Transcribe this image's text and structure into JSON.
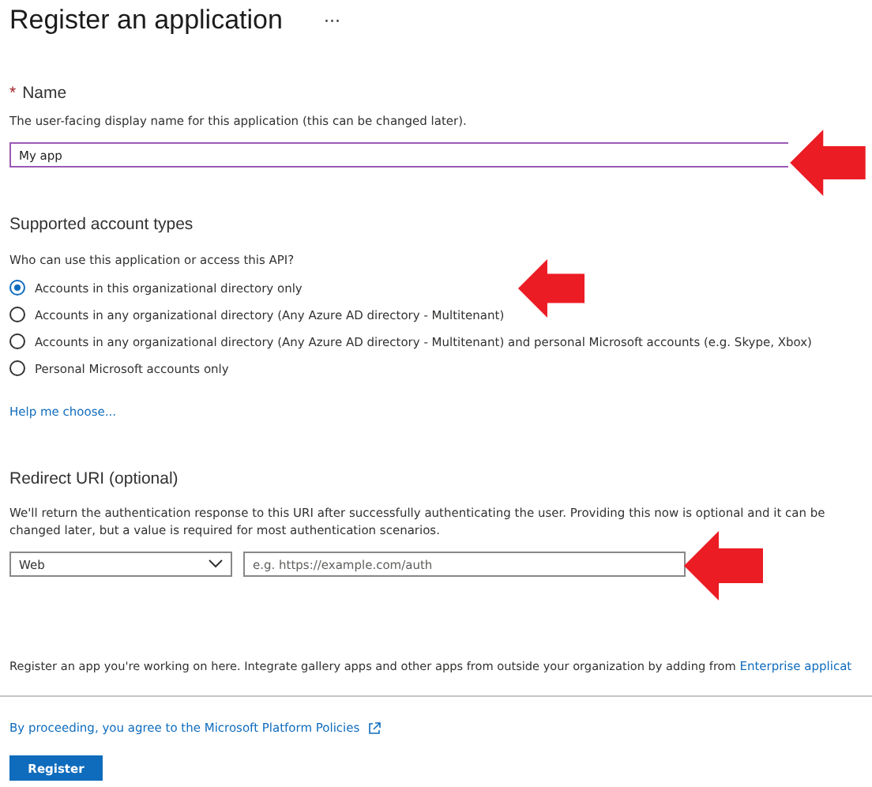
{
  "header": {
    "title": "Register an application",
    "more": "···"
  },
  "name_section": {
    "required_mark": "*",
    "label": "Name",
    "description": "The user-facing display name for this application (this can be changed later).",
    "value": "My app"
  },
  "account_types": {
    "heading": "Supported account types",
    "question": "Who can use this application or access this API?",
    "options": [
      {
        "label": "Accounts in this organizational directory only",
        "selected": true
      },
      {
        "label": "Accounts in any organizational directory (Any Azure AD directory - Multitenant)",
        "selected": false
      },
      {
        "label": "Accounts in any organizational directory (Any Azure AD directory - Multitenant) and personal Microsoft accounts (e.g. Skype, Xbox)",
        "selected": false
      },
      {
        "label": "Personal Microsoft accounts only",
        "selected": false
      }
    ],
    "help_link": "Help me choose..."
  },
  "redirect": {
    "heading": "Redirect URI (optional)",
    "description": "We'll return the authentication response to this URI after successfully authenticating the user. Providing this now is optional and it can be changed later, but a value is required for most authentication scenarios.",
    "platform": "Web",
    "placeholder": "e.g. https://example.com/auth"
  },
  "footer_note": {
    "text": "Register an app you're working on here. Integrate gallery apps and other apps from outside your organization by adding from ",
    "link": "Enterprise applicat"
  },
  "policy_link": "By proceeding, you agree to the Microsoft Platform Policies",
  "buttons": [
    "Register"
  ]
}
